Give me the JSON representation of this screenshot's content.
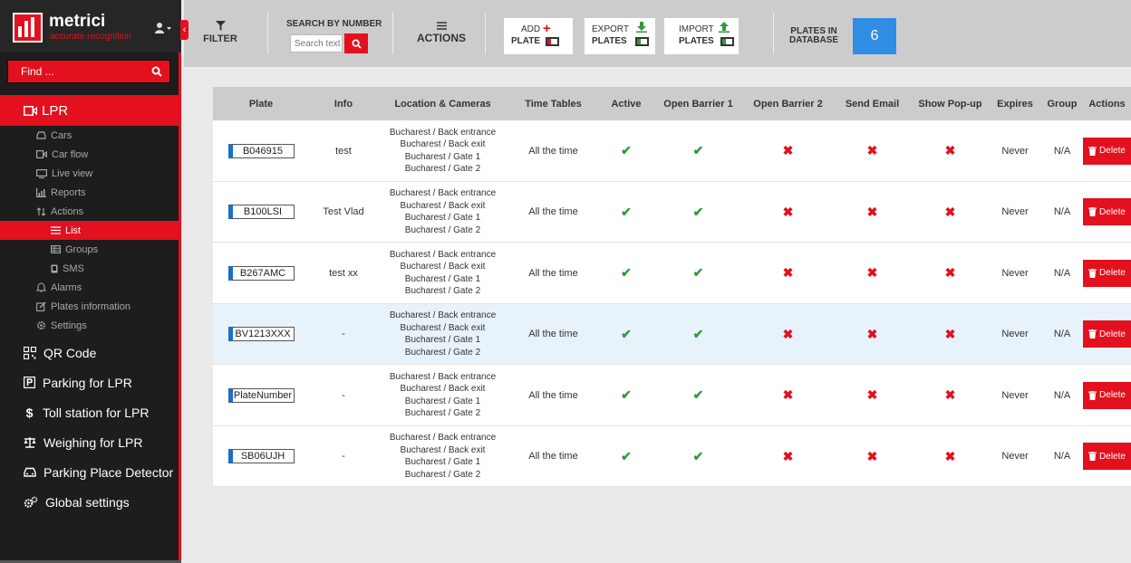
{
  "app": {
    "name": "metrici",
    "tagline": "accurate recognition"
  },
  "search": {
    "placeholder": "Find ..."
  },
  "sidebar": {
    "lpr_label": "LPR",
    "lpr_subitems": [
      {
        "label": "Cars",
        "icon": "car-icon"
      },
      {
        "label": "Car flow",
        "icon": "video-icon"
      },
      {
        "label": "Live view",
        "icon": "monitor-icon"
      },
      {
        "label": "Reports",
        "icon": "chart-icon"
      },
      {
        "label": "Actions",
        "icon": "arrows-icon"
      }
    ],
    "actions_subitems": [
      {
        "label": "List",
        "icon": "list-icon",
        "active": true
      },
      {
        "label": "Groups",
        "icon": "table-icon"
      },
      {
        "label": "SMS",
        "icon": "phone-icon"
      }
    ],
    "lpr_subitems_after": [
      {
        "label": "Alarms",
        "icon": "bell-icon"
      },
      {
        "label": "Plates information",
        "icon": "edit-icon"
      },
      {
        "label": "Settings",
        "icon": "gear-icon"
      }
    ],
    "main_items": [
      {
        "label": "QR Code",
        "icon": "qr-icon"
      },
      {
        "label": "Parking for LPR",
        "icon": "parking-icon"
      },
      {
        "label": "Toll station for LPR",
        "icon": "dollar-icon"
      },
      {
        "label": "Weighing for LPR",
        "icon": "scale-icon"
      },
      {
        "label": "Parking Place Detector",
        "icon": "car-icon"
      },
      {
        "label": "Global settings",
        "icon": "gears-icon"
      }
    ]
  },
  "toolbar": {
    "filter_label": "FILTER",
    "search_label": "SEARCH BY NUMBER",
    "search_placeholder": "Search text",
    "actions_label": "ACTIONS",
    "add_line1": "ADD",
    "add_line2": "PLATE",
    "export_line1": "EXPORT",
    "export_line2": "PLATES",
    "import_line1": "IMPORT",
    "import_line2": "PLATES",
    "plates_label_line1": "PLATES IN",
    "plates_label_line2": "DATABASE",
    "plates_count": "6"
  },
  "table": {
    "headers": [
      "Plate",
      "Info",
      "Location & Cameras",
      "Time Tables",
      "Active",
      "Open Barrier 1",
      "Open Barrier 2",
      "Send Email",
      "Show Pop-up",
      "Expires",
      "Group",
      "Actions"
    ],
    "delete_label": "Delete",
    "rows": [
      {
        "plate": "B046915",
        "info": "test",
        "locations": [
          "Bucharest / Back entrance",
          "Bucharest / Back exit",
          "Bucharest / Gate 1",
          "Bucharest / Gate 2"
        ],
        "time_tables": "All the time",
        "active": true,
        "open_barrier_1": true,
        "open_barrier_2": false,
        "send_email": false,
        "show_popup": false,
        "expires": "Never",
        "group": "N/A"
      },
      {
        "plate": "B100LSI",
        "info": "Test Vlad",
        "locations": [
          "Bucharest / Back entrance",
          "Bucharest / Back exit",
          "Bucharest / Gate 1",
          "Bucharest / Gate 2"
        ],
        "time_tables": "All the time",
        "active": true,
        "open_barrier_1": true,
        "open_barrier_2": false,
        "send_email": false,
        "show_popup": false,
        "expires": "Never",
        "group": "N/A"
      },
      {
        "plate": "B267AMC",
        "info": "test xx",
        "locations": [
          "Bucharest / Back entrance",
          "Bucharest / Back exit",
          "Bucharest / Gate 1",
          "Bucharest / Gate 2"
        ],
        "time_tables": "All the time",
        "active": true,
        "open_barrier_1": true,
        "open_barrier_2": false,
        "send_email": false,
        "show_popup": false,
        "expires": "Never",
        "group": "N/A"
      },
      {
        "plate": "BV1213XXX",
        "info": "-",
        "locations": [
          "Bucharest / Back entrance",
          "Bucharest / Back exit",
          "Bucharest / Gate 1",
          "Bucharest / Gate 2"
        ],
        "time_tables": "All the time",
        "active": true,
        "open_barrier_1": true,
        "open_barrier_2": false,
        "send_email": false,
        "show_popup": false,
        "expires": "Never",
        "group": "N/A",
        "highlighted": true
      },
      {
        "plate": "PlateNumber",
        "info": "-",
        "locations": [
          "Bucharest / Back entrance",
          "Bucharest / Back exit",
          "Bucharest / Gate 1",
          "Bucharest / Gate 2"
        ],
        "time_tables": "All the time",
        "active": true,
        "open_barrier_1": true,
        "open_barrier_2": false,
        "send_email": false,
        "show_popup": false,
        "expires": "Never",
        "group": "N/A"
      },
      {
        "plate": "SB06UJH",
        "info": "-",
        "locations": [
          "Bucharest / Back entrance",
          "Bucharest / Back exit",
          "Bucharest / Gate 1",
          "Bucharest / Gate 2"
        ],
        "time_tables": "All the time",
        "active": true,
        "open_barrier_1": true,
        "open_barrier_2": false,
        "send_email": false,
        "show_popup": false,
        "expires": "Never",
        "group": "N/A"
      }
    ]
  },
  "colors": {
    "accent": "#e3101d",
    "sidebar_bg": "#1d1d1d",
    "check": "#2e9b3d",
    "count_badge": "#2f8de4",
    "plate_stripe": "#1a6fc7"
  }
}
